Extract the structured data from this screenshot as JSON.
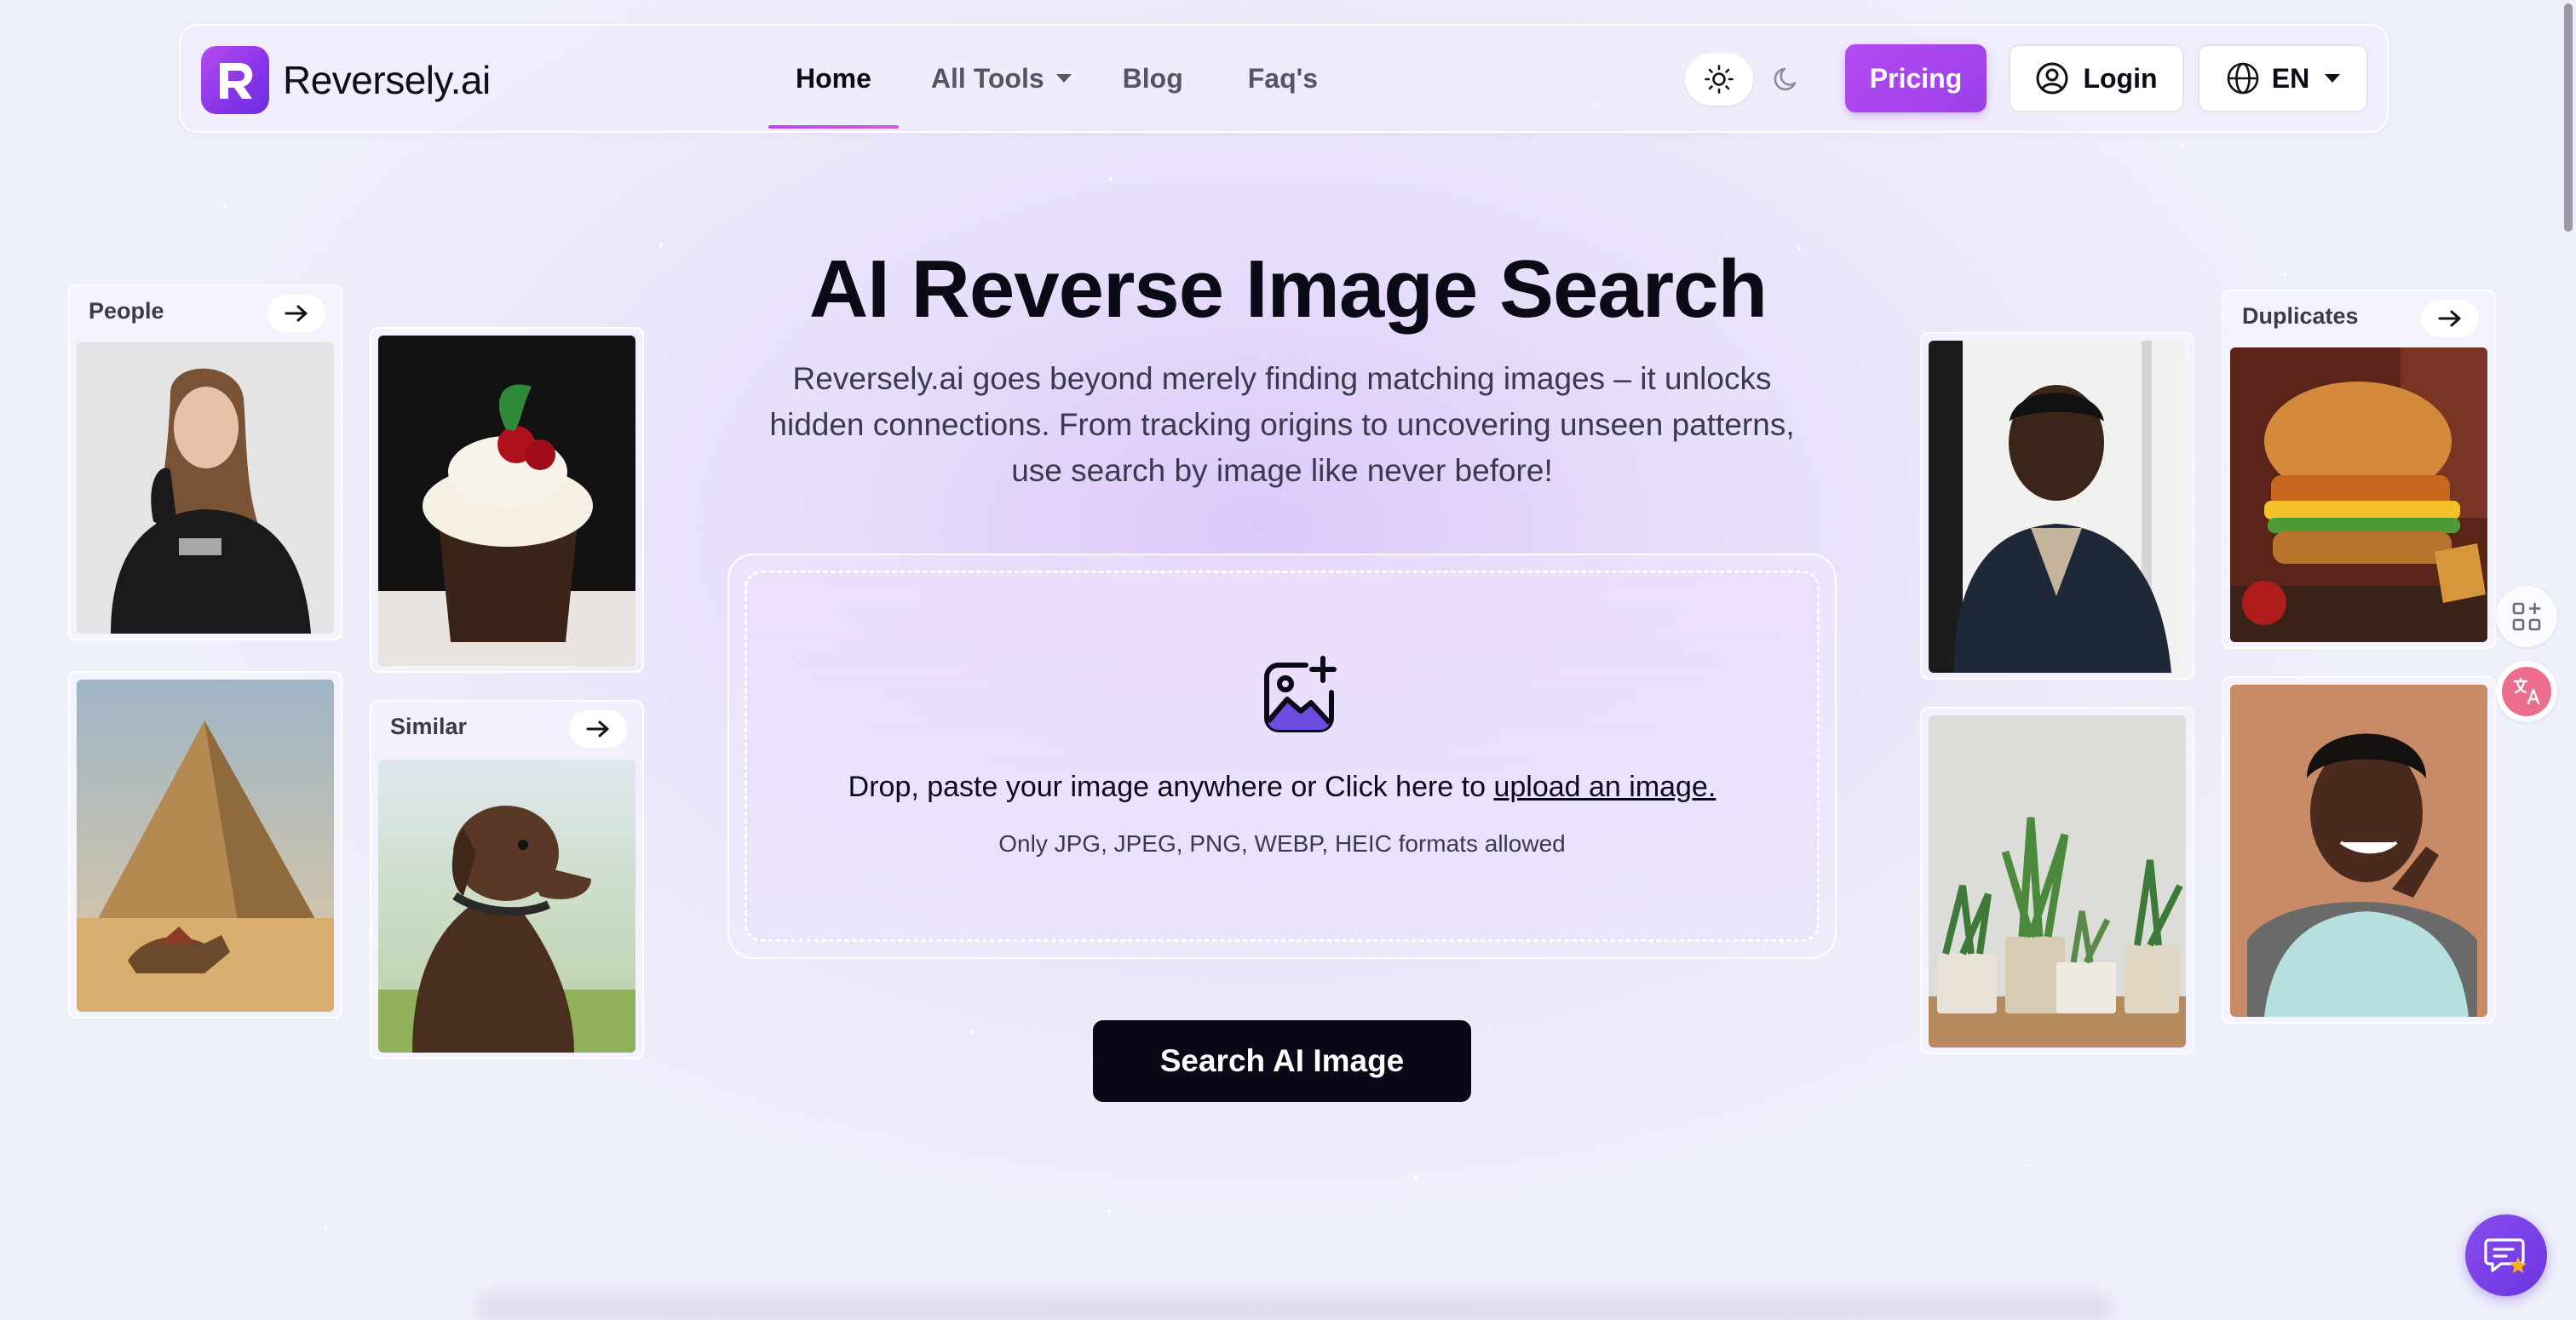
{
  "header": {
    "brand": "Reversely.ai",
    "nav": [
      {
        "label": "Home",
        "active": true
      },
      {
        "label": "All Tools",
        "dropdown": true
      },
      {
        "label": "Blog"
      },
      {
        "label": "Faq's"
      }
    ],
    "theme_icons": [
      "sun-icon",
      "moon-icon"
    ],
    "pricing_label": "Pricing",
    "login_label": "Login",
    "language": "EN"
  },
  "hero": {
    "title": "AI Reverse Image Search",
    "description": "Reversely.ai goes beyond merely finding matching images – it unlocks hidden connections. From tracking origins to uncovering unseen patterns, use search by image like never before!"
  },
  "upload": {
    "text_prefix": "Drop, paste your image anywhere or Click here to ",
    "link_text": "upload an image.",
    "formats": "Only JPG, JPEG, PNG, WEBP, HEIC formats allowed",
    "icon": "image-plus-icon"
  },
  "search_button": "Search AI Image",
  "cards": {
    "people": "People",
    "similar": "Similar",
    "duplicates": "Duplicates",
    "photos": [
      "woman-hoodie-photo",
      "cupcake-photo",
      "pyramid-camel-photo",
      "dog-photo",
      "man-portrait-photo",
      "plants-photo",
      "burger-photo",
      "woman-smiling-photo"
    ]
  },
  "colors": {
    "accent": "#a544ee",
    "primary_dark": "#080816",
    "background": "#eceaf9"
  }
}
